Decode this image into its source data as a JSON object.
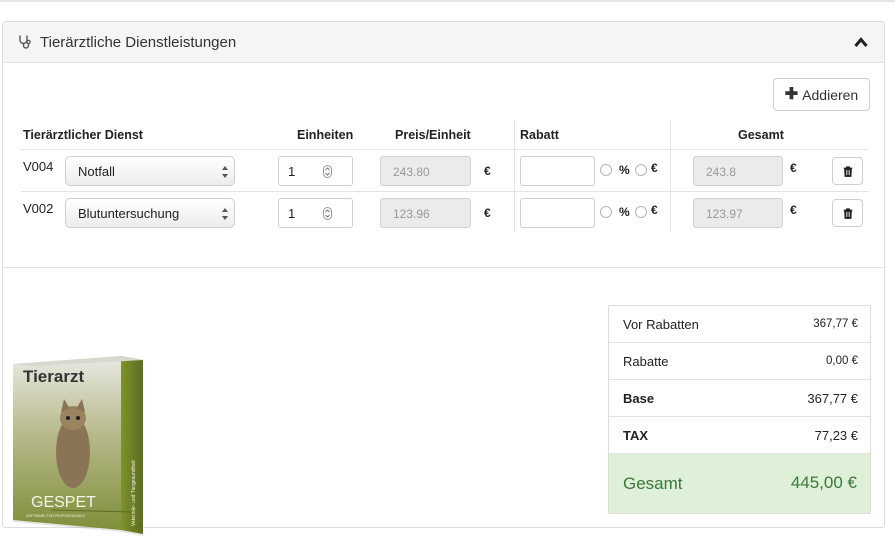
{
  "panel": {
    "title": "Tierärztliche Dienstleistungen",
    "icons": {
      "header": "stethoscope-icon",
      "collapse": "chevron-up-icon"
    }
  },
  "toolbar": {
    "add_label": "Addieren",
    "add_icon": "plus-icon"
  },
  "table": {
    "headers": {
      "service": "Tierärztlicher Dienst",
      "units": "Einheiten",
      "unit_price": "Preis/Einheit",
      "discount": "Rabatt",
      "total": "Gesamt"
    },
    "discount_options": {
      "percent": "%",
      "euro": "€"
    },
    "currency": "€",
    "rows": [
      {
        "code": "V004",
        "service": "Notfall",
        "units": "1",
        "unit_price": "243.80",
        "discount": "",
        "total": "243.8"
      },
      {
        "code": "V002",
        "service": "Blutuntersuchung",
        "units": "1",
        "unit_price": "123.96",
        "discount": "",
        "total": "123.97"
      }
    ]
  },
  "product": {
    "title": "Tierarzt",
    "brand": "GESPET",
    "tagline": "Veterinär- und Tiergesundheit",
    "footer": "SOFTWARE FÜR PROFESSIONALS"
  },
  "summary": {
    "before_discounts": {
      "label": "Vor Rabatten",
      "value": "367,77 €"
    },
    "discounts": {
      "label": "Rabatte",
      "value": "0,00 €"
    },
    "base": {
      "label": "Base",
      "value": "367,77 €"
    },
    "tax": {
      "label": "TAX",
      "value": "77,23 €"
    },
    "total": {
      "label": "Gesamt",
      "value": "445,00 €"
    }
  },
  "colors": {
    "success_bg": "#dff0d8",
    "success_text": "#3c763d",
    "header_bg": "#f5f5f5"
  }
}
